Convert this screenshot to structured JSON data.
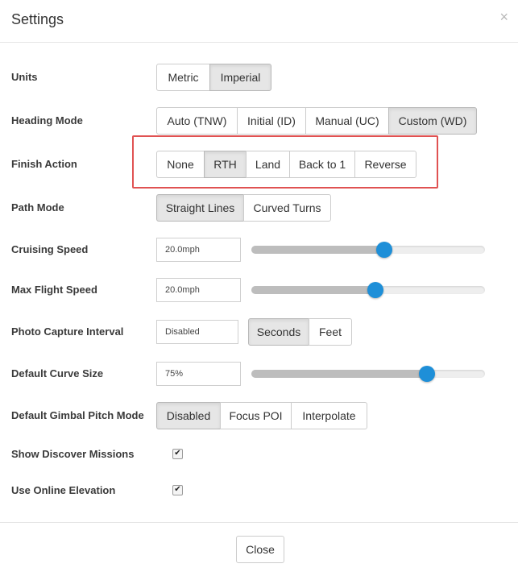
{
  "dialog": {
    "title": "Settings",
    "close_icon": "×"
  },
  "units": {
    "label": "Units",
    "options": [
      "Metric",
      "Imperial"
    ],
    "selected": "Imperial"
  },
  "heading_mode": {
    "label": "Heading Mode",
    "options": [
      "Auto (TNW)",
      "Initial (ID)",
      "Manual (UC)",
      "Custom (WD)"
    ],
    "selected": "Custom (WD)"
  },
  "finish_action": {
    "label": "Finish Action",
    "options": [
      "None",
      "RTH",
      "Land",
      "Back to 1",
      "Reverse"
    ],
    "selected": "RTH",
    "highlight_color": "#e05252"
  },
  "path_mode": {
    "label": "Path Mode",
    "options": [
      "Straight Lines",
      "Curved Turns"
    ],
    "selected": "Straight Lines"
  },
  "cruising_speed": {
    "label": "Cruising Speed",
    "value": "20.0mph",
    "slider_fraction": 0.57
  },
  "max_flight_speed": {
    "label": "Max Flight Speed",
    "value": "20.0mph",
    "slider_fraction": 0.53
  },
  "photo_capture_interval": {
    "label": "Photo Capture Interval",
    "value": "Disabled",
    "options": [
      "Seconds",
      "Feet"
    ],
    "selected": "Seconds"
  },
  "default_curve_size": {
    "label": "Default Curve Size",
    "value": "75%",
    "slider_fraction": 0.75
  },
  "default_gimbal_pitch_mode": {
    "label": "Default Gimbal Pitch Mode",
    "options": [
      "Disabled",
      "Focus POI",
      "Interpolate"
    ],
    "selected": "Disabled"
  },
  "show_discover_missions": {
    "label": "Show Discover Missions",
    "checked": true
  },
  "use_online_elevation": {
    "label": "Use Online Elevation",
    "checked": true
  },
  "footer": {
    "close_label": "Close"
  },
  "colors": {
    "slider_thumb": "#1e8fd8",
    "active_button": "#e6e6e6"
  }
}
